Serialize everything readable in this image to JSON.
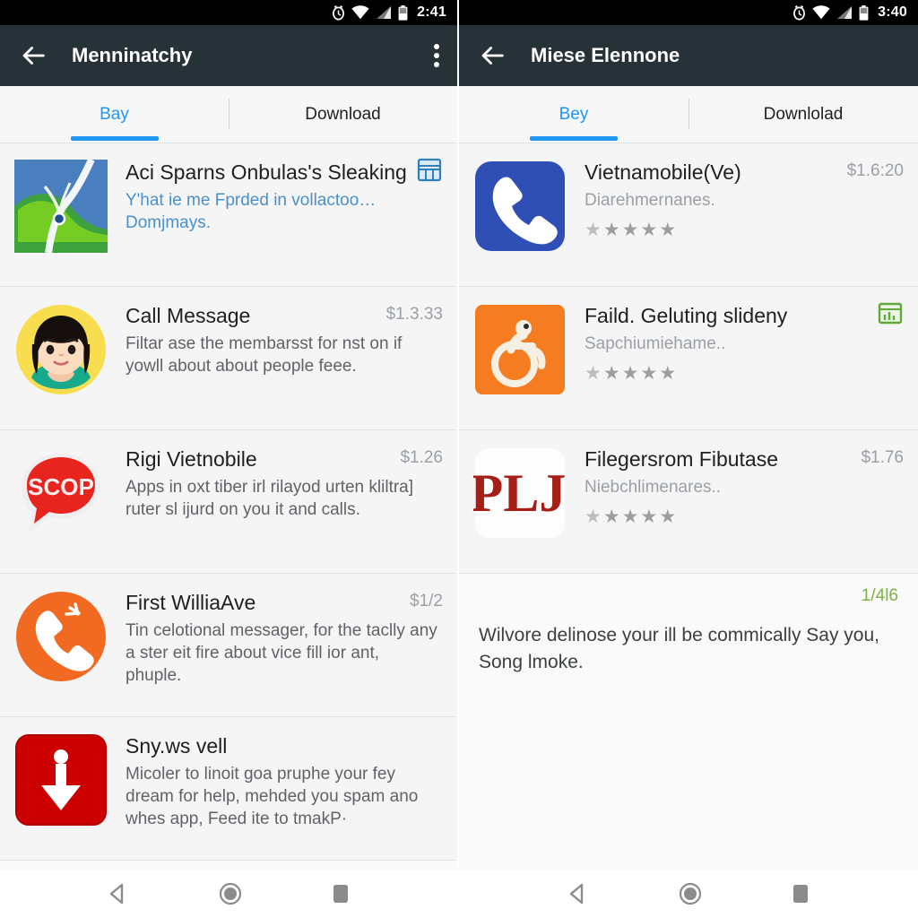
{
  "panels": [
    {
      "status": {
        "time": "2:41",
        "icons": [
          "alarm-icon",
          "wifi-icon",
          "signal-icon",
          "battery-icon"
        ]
      },
      "appbar": {
        "title": "Menninatchy",
        "back": "back-arrow-icon",
        "menu": "overflow-menu-icon"
      },
      "tabs": [
        {
          "label": "Bay",
          "active": true
        },
        {
          "label": "Download",
          "active": false
        }
      ],
      "rows": [
        {
          "icon": "map-terrain-icon",
          "title": "Aci Sparns Onbulas's Sleaking",
          "sub1": "Y'hat ie me Fprded in vollactoo…",
          "sub2": "Domjmays.",
          "sub_style": "link",
          "badge": "blue-grid-badge-icon",
          "price": ""
        },
        {
          "icon": "woman-avatar-icon",
          "title": "Call Message",
          "sub1": "Filtar ase the membarsst for nst on if yowll about about people feee.",
          "sub2": "",
          "sub_style": "plain",
          "badge": "",
          "price": "$1.3.33"
        },
        {
          "icon": "scop-bubble-icon",
          "title": "Rigi Vietnobile",
          "sub1": "Apps in oxt tiber irl rilayod urten kliltra] ruter sl ijurd on you it and calls.",
          "sub2": "",
          "sub_style": "plain",
          "badge": "",
          "price": "$1.26"
        },
        {
          "icon": "orange-phone-icon",
          "title": "First WilliaAve",
          "sub1": "Tin celotional messager, for the taclly any a ster eit fire about vice fill ior ant, phuple.",
          "sub2": "",
          "sub_style": "plain",
          "badge": "",
          "price": "$1/2"
        },
        {
          "icon": "red-download-icon",
          "title": "Sny.ws vell",
          "sub1": "Micoler to linoit goa pruphe your fey dream for help, mehded you spam ano whes app, Feed ite to tmakP·",
          "sub2": "",
          "sub_style": "plain",
          "badge": "",
          "price": ""
        }
      ],
      "notice": null,
      "nav": [
        "back-nav-icon",
        "home-nav-icon",
        "recents-nav-icon"
      ]
    },
    {
      "status": {
        "time": "3:40",
        "icons": [
          "alarm-icon",
          "wifi-icon",
          "signal-icon",
          "battery-icon"
        ]
      },
      "appbar": {
        "title": "Miese Elennone",
        "back": "back-arrow-icon",
        "menu": ""
      },
      "tabs": [
        {
          "label": "Bey",
          "active": true
        },
        {
          "label": "Downlolad",
          "active": false
        }
      ],
      "rows": [
        {
          "icon": "blue-phone-icon",
          "title": "Vietnamobile(Ve)",
          "sub1": "Diarehmernanes.",
          "sub2": "",
          "sub_style": "muted",
          "badge": "",
          "price": "$1.6:20",
          "stars": 5
        },
        {
          "icon": "orange-accessibility-icon",
          "title": "Faild. Geluting slideny",
          "sub1": "Sapchiumiehame..",
          "sub2": "",
          "sub_style": "muted",
          "badge": "green-chart-badge-icon",
          "price": "",
          "stars": 5
        },
        {
          "icon": "pl-letters-icon",
          "title": "Filegersrom Fibutase",
          "sub1": "Niebchlimenares..",
          "sub2": "",
          "sub_style": "muted",
          "badge": "",
          "price": "$1.76",
          "stars": 5
        }
      ],
      "notice": {
        "count": "1/4l6",
        "text": "Wilvore delinose your ill be commically Say you, Song lmoke."
      },
      "nav": [
        "back-nav-icon",
        "home-nav-icon",
        "recents-nav-icon"
      ]
    }
  ],
  "colors": {
    "appbar": "#263238",
    "accent": "#2196f3",
    "link": "#4a90c9",
    "green": "#7cb342",
    "price": "#9aa0a6"
  },
  "star_glyph": "★"
}
